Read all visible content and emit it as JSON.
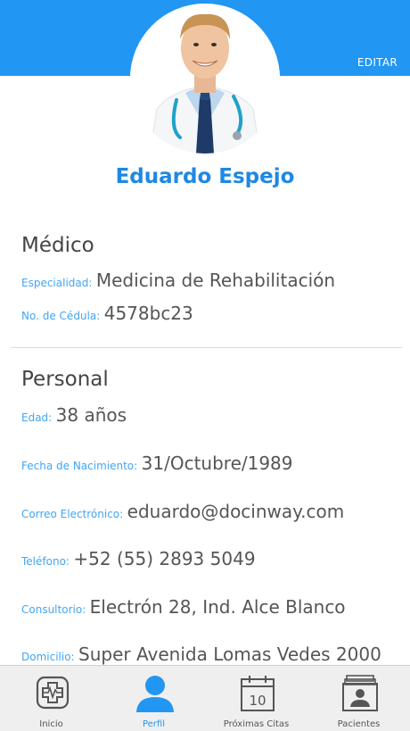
{
  "header": {
    "edit_label": "EDITAR"
  },
  "profile": {
    "name": "Eduardo Espejo"
  },
  "medico": {
    "title": "Médico",
    "fields": [
      {
        "label": "Especialidad:",
        "value": "Medicina de Rehabilitación"
      },
      {
        "label": "No. de Cédula:",
        "value": "4578bc23"
      }
    ]
  },
  "personal": {
    "title": "Personal",
    "fields": [
      {
        "label": "Edad:",
        "value": "38 años"
      },
      {
        "label": "Fecha de Nacimiento:",
        "value": "31/Octubre/1989"
      },
      {
        "label": "Correo Electrónico:",
        "value": "eduardo@docinway.com"
      },
      {
        "label": "Teléfono:",
        "value": "+52 (55) 2893 5049"
      },
      {
        "label": "Consultorio:",
        "value": "Electrón 28, Ind. Alce Blanco"
      },
      {
        "label": "Domicilio:",
        "value": "Super Avenida Lomas Vedes 2000"
      }
    ]
  },
  "tabs": [
    {
      "label": "Inicio",
      "icon": "home-cross-icon"
    },
    {
      "label": "Perfil",
      "icon": "person-icon"
    },
    {
      "label": "Próximas Citas",
      "icon": "calendar-icon",
      "calendar_day": "10"
    },
    {
      "label": "Pacientes",
      "icon": "patients-icon"
    }
  ],
  "colors": {
    "accent": "#2196f3",
    "label": "#42a5f5",
    "value": "#555555"
  }
}
